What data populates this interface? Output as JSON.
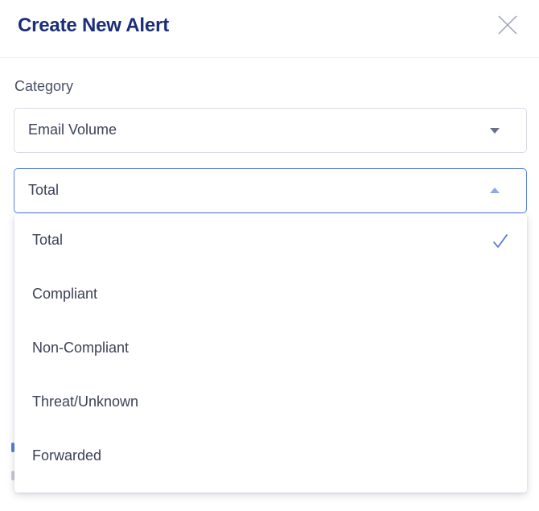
{
  "modal": {
    "title": "Create New Alert"
  },
  "form": {
    "category_label": "Category",
    "category_value": "Email Volume",
    "metric_value": "Total",
    "metric_options": [
      {
        "label": "Total",
        "selected": true
      },
      {
        "label": "Compliant",
        "selected": false
      },
      {
        "label": "Non-Compliant",
        "selected": false
      },
      {
        "label": "Threat/Unknown",
        "selected": false
      },
      {
        "label": "Forwarded",
        "selected": false
      }
    ]
  },
  "icons": {
    "close": "close-icon",
    "caret_down": "caret-down-icon",
    "caret_up": "caret-up-icon",
    "check": "check-icon"
  },
  "colors": {
    "title": "#1a2e7a",
    "accent": "#5b7fd8",
    "text": "#3c4257",
    "border": "#d8dbe2"
  }
}
